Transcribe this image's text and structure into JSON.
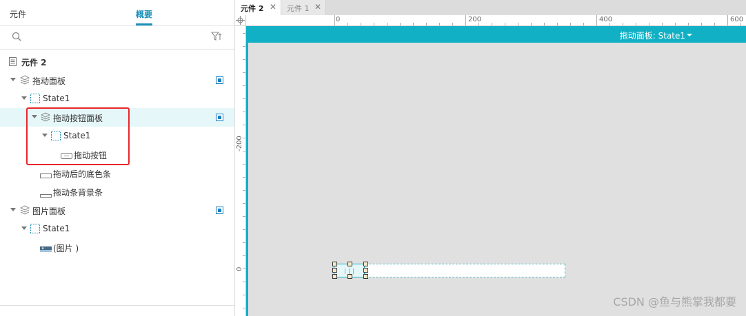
{
  "left_panel": {
    "tabs": [
      {
        "label": "元件",
        "active": false
      },
      {
        "label": "概要",
        "active": true
      }
    ],
    "search": {
      "placeholder": "",
      "value": ""
    },
    "tree": [
      {
        "label": "元件 2",
        "icon": "page-icon",
        "bold": true
      },
      {
        "label": "拖动面板",
        "icon": "layers-icon",
        "expanded": true,
        "visible_toggle": true
      },
      {
        "label": "State1",
        "icon": "state-icon",
        "expanded": true
      },
      {
        "label": "拖动按钮面板",
        "icon": "layers-icon",
        "expanded": true,
        "selected": true,
        "visible_toggle": true
      },
      {
        "label": "State1",
        "icon": "state-icon",
        "expanded": true
      },
      {
        "label": "拖动按钮",
        "icon": "button-icon"
      },
      {
        "label": "拖动后的底色条",
        "icon": "rectangle-icon"
      },
      {
        "label": "拖动条背景条",
        "icon": "rectangle-icon"
      },
      {
        "label": "图片面板",
        "icon": "layers-icon",
        "expanded": true,
        "visible_toggle": true
      },
      {
        "label": "State1",
        "icon": "state-icon",
        "expanded": true
      },
      {
        "label": "(图片 )",
        "icon": "image-icon"
      }
    ]
  },
  "doc_tabs": [
    {
      "label": "元件 2",
      "active": true
    },
    {
      "label": "元件 1",
      "active": false
    }
  ],
  "ruler": {
    "h_labels": [
      "0",
      "200",
      "400",
      "600"
    ],
    "v_labels": [
      "-200",
      "0"
    ]
  },
  "canvas": {
    "dynamic_panel_title": "拖动面板: State1",
    "accent_color": "#11b0c4"
  },
  "watermark": "CSDN @鱼与熊掌我都要"
}
